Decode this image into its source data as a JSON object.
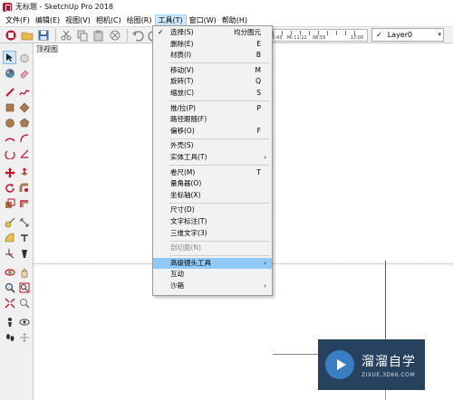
{
  "window": {
    "title": "无标题 - SketchUp Pro 2018"
  },
  "menubar": {
    "items": [
      "文件(F)",
      "编辑(E)",
      "视图(V)",
      "相机(C)",
      "绘图(R)",
      "工具(T)",
      "窗口(W)",
      "帮助(H)"
    ]
  },
  "toolbar": {
    "shadow_times": [
      "06:43",
      "Mi 11:12",
      "08:55",
      "17:00"
    ],
    "layer_value": "Layer0"
  },
  "viewport": {
    "scene_label": "顶视图"
  },
  "tools_menu": {
    "items": [
      {
        "label": "选择(S)",
        "shortcut": "均分图元",
        "checked": true
      },
      {
        "label": "删除(E)",
        "shortcut": "E"
      },
      {
        "label": "材质(I)",
        "shortcut": "B"
      },
      {
        "label": "移动(V)",
        "shortcut": "M"
      },
      {
        "label": "旋转(T)",
        "shortcut": "Q"
      },
      {
        "label": "缩放(C)",
        "shortcut": "S"
      },
      {
        "label": "推/拉(P)",
        "shortcut": "P"
      },
      {
        "label": "路径跟随(F)",
        "shortcut": ""
      },
      {
        "label": "偏移(O)",
        "shortcut": "F"
      },
      {
        "label": "外壳(S)",
        "shortcut": ""
      },
      {
        "label": "实体工具(T)",
        "shortcut": ""
      },
      {
        "label": "卷尺(M)",
        "shortcut": "T"
      },
      {
        "label": "量角器(O)",
        "shortcut": ""
      },
      {
        "label": "坐标轴(X)",
        "shortcut": ""
      },
      {
        "label": "尺寸(D)",
        "shortcut": ""
      },
      {
        "label": "文字标注(T)",
        "shortcut": ""
      },
      {
        "label": "三维文字(3)",
        "shortcut": ""
      },
      {
        "label": "剖切面(N)",
        "shortcut": ""
      },
      {
        "label": "高级镜头工具",
        "shortcut": ""
      },
      {
        "label": "互动",
        "shortcut": ""
      },
      {
        "label": "沙箱",
        "shortcut": ""
      }
    ]
  },
  "watermark": {
    "title": "溜溜自学",
    "subtitle": "ZIXUE.3D66.COM"
  },
  "colors": {
    "menu_highlight": "#91c9f7",
    "watermark_bg": "#27425e",
    "brand_red": "#c8102e"
  }
}
